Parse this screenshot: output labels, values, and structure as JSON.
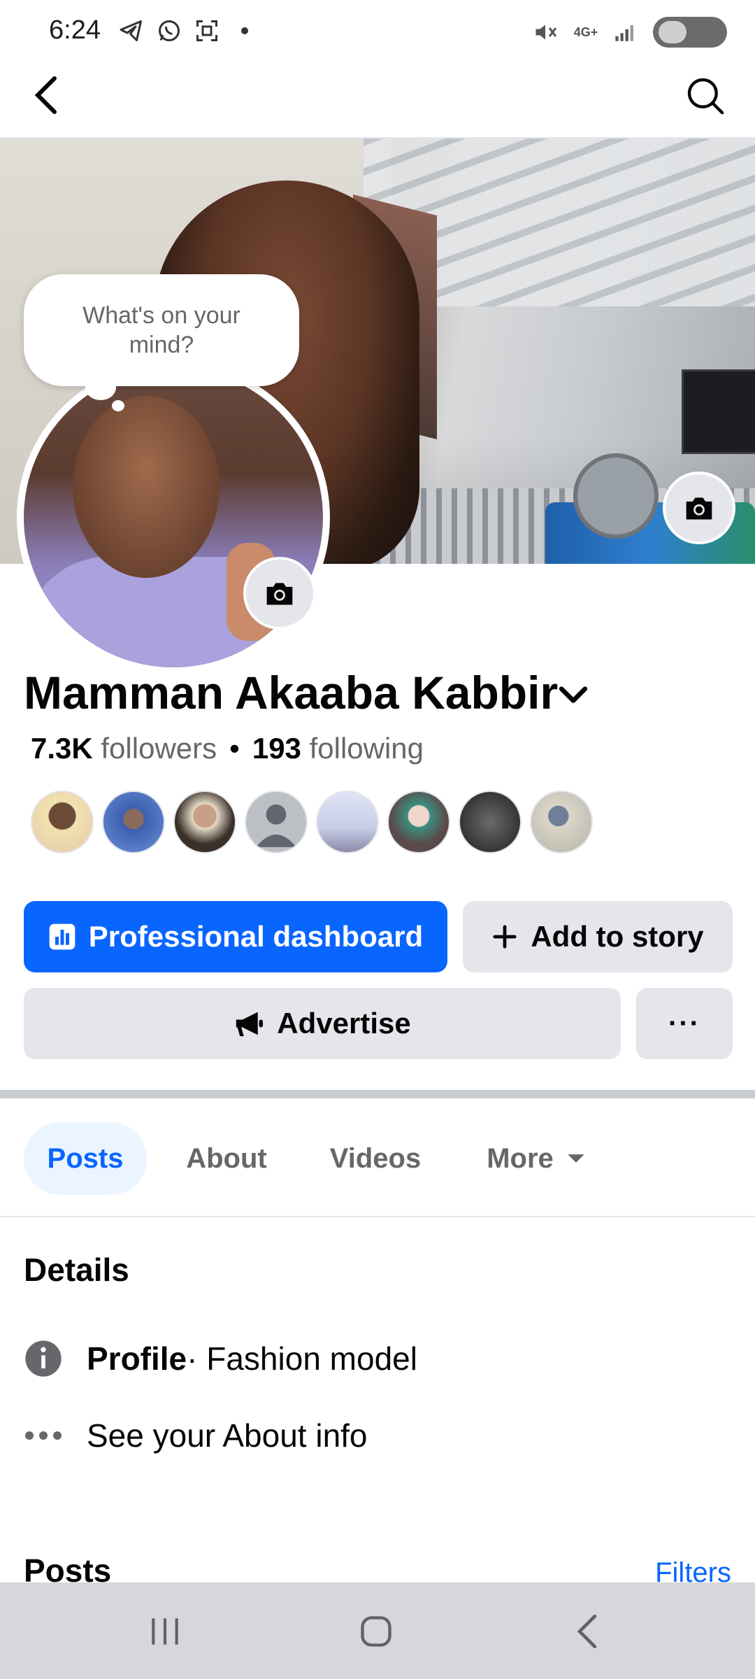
{
  "status_bar": {
    "time": "6:24",
    "network": "4G+"
  },
  "header": {
    "back_icon": "chevron-left-icon",
    "search_icon": "search-icon"
  },
  "profile": {
    "thought_bubble": "What's on your mind?",
    "name": "Mamman Akaaba Kabbir",
    "followers_count": "7.3K",
    "followers_label": "followers",
    "following_count": "193",
    "following_label": "following"
  },
  "friend_avatars": [
    {
      "color": "#e6c9a8"
    },
    {
      "color": "#6a8fd6"
    },
    {
      "color": "#3b2f2a"
    },
    {
      "color": "#bcc0c4"
    },
    {
      "color": "#c7cde8"
    },
    {
      "color": "#5b4a4a"
    },
    {
      "color": "#2e2e2e"
    },
    {
      "color": "#b5b3a8"
    }
  ],
  "actions": {
    "professional_dashboard": "Professional dashboard",
    "add_to_story": "Add to story",
    "advertise": "Advertise",
    "more": "···"
  },
  "tabs": [
    {
      "label": "Posts",
      "active": true
    },
    {
      "label": "About",
      "active": false
    },
    {
      "label": "Videos",
      "active": false
    },
    {
      "label": "More",
      "active": false
    }
  ],
  "details": {
    "title": "Details",
    "profile_label": "Profile",
    "profile_value": " · Fashion model",
    "about_link": "See your About info"
  },
  "posts": {
    "title": "Posts",
    "filters": "Filters"
  },
  "colors": {
    "accent": "#0866ff",
    "secondary_button": "#e4e6eb",
    "muted_text": "#65676b"
  }
}
